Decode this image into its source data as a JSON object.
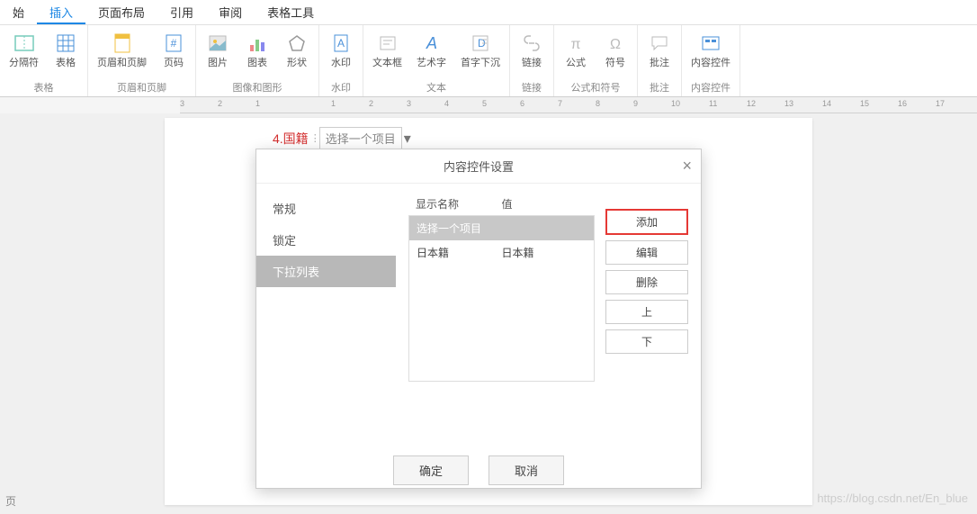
{
  "tabs": [
    "始",
    "插入",
    "页面布局",
    "引用",
    "审阅",
    "表格工具"
  ],
  "active_tab_index": 1,
  "ribbon": {
    "groups": [
      {
        "label": "表格",
        "items": [
          {
            "label": "分隔符",
            "icon": "split-icon"
          },
          {
            "label": "表格",
            "icon": "table-icon"
          }
        ]
      },
      {
        "label": "页眉和页脚",
        "items": [
          {
            "label": "页眉和页脚",
            "icon": "header-footer-icon"
          },
          {
            "label": "页码",
            "icon": "page-number-icon"
          }
        ]
      },
      {
        "label": "图像和图形",
        "items": [
          {
            "label": "图片",
            "icon": "picture-icon"
          },
          {
            "label": "图表",
            "icon": "chart-icon"
          },
          {
            "label": "形状",
            "icon": "shape-icon"
          }
        ]
      },
      {
        "label": "水印",
        "items": [
          {
            "label": "水印",
            "icon": "watermark-icon"
          }
        ]
      },
      {
        "label": "文本",
        "items": [
          {
            "label": "文本框",
            "icon": "textbox-icon"
          },
          {
            "label": "艺术字",
            "icon": "wordart-icon"
          },
          {
            "label": "首字下沉",
            "icon": "dropcap-icon"
          }
        ]
      },
      {
        "label": "链接",
        "items": [
          {
            "label": "链接",
            "icon": "link-icon"
          }
        ]
      },
      {
        "label": "公式和符号",
        "items": [
          {
            "label": "公式",
            "icon": "equation-icon"
          },
          {
            "label": "符号",
            "icon": "symbol-icon"
          }
        ]
      },
      {
        "label": "批注",
        "items": [
          {
            "label": "批注",
            "icon": "comment-icon"
          }
        ]
      },
      {
        "label": "内容控件",
        "items": [
          {
            "label": "内容控件",
            "icon": "content-control-icon"
          }
        ]
      }
    ]
  },
  "ruler_marks": [
    "3",
    "2",
    "1",
    "",
    "1",
    "2",
    "3",
    "4",
    "5",
    "6",
    "7",
    "8",
    "9",
    "10",
    "11",
    "12",
    "13",
    "14",
    "15",
    "16",
    "17"
  ],
  "field": {
    "label": "4.国籍",
    "value": "选择一个项目"
  },
  "dialog": {
    "title": "内容控件设置",
    "sidebar": [
      "常规",
      "锁定",
      "下拉列表"
    ],
    "sidebar_selected_index": 2,
    "list_headers": [
      "显示名称",
      "值"
    ],
    "list_rows": [
      {
        "display": "选择一个项目",
        "value": ""
      },
      {
        "display": "日本籍",
        "value": "日本籍"
      }
    ],
    "list_selected_index": 0,
    "buttons": [
      "添加",
      "编辑",
      "删除",
      "上",
      "下"
    ],
    "highlighted_button_index": 0,
    "footer": {
      "ok": "确定",
      "cancel": "取消"
    }
  },
  "page_indicator": "页",
  "watermark": "https://blog.csdn.net/En_blue"
}
